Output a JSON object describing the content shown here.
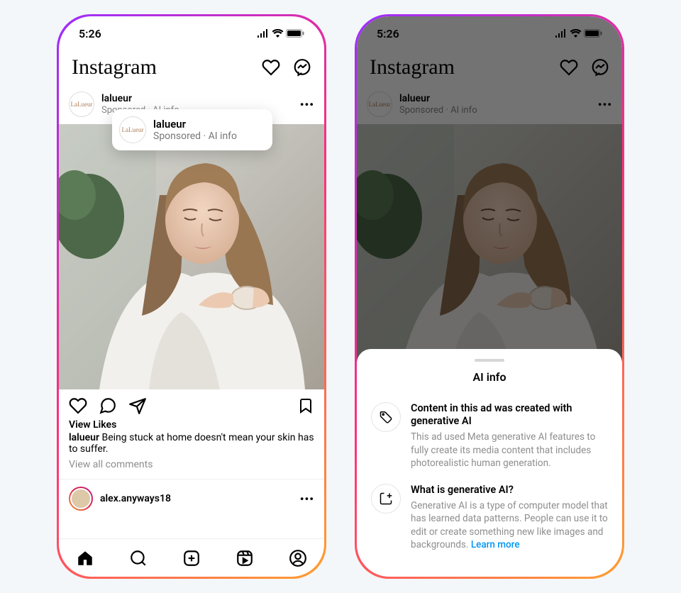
{
  "status": {
    "time": "5:26"
  },
  "header": {
    "logo_text": "Instagram"
  },
  "post": {
    "username": "lalueur",
    "sponsored_line": "Sponsored · AI info",
    "view_likes": "View Likes",
    "caption_user": "lalueur",
    "caption_text": " Being stuck at home doesn't mean your skin has to suffer.",
    "view_comments": "View all comments"
  },
  "next_post": {
    "username": "alex.anyways18"
  },
  "popup": {
    "name": "lalueur",
    "sub": "Sponsored · AI info"
  },
  "sheet": {
    "title": "AI info",
    "row1": {
      "title": "Content in this ad was created with generative AI",
      "body": "This ad used Meta generative AI features to fully create its media content that includes photorealistic human generation."
    },
    "row2": {
      "title": "What is generative AI?",
      "body": "Generative AI is a type of computer model that has learned data patterns. People can use it to edit or create something new like images and backgrounds. ",
      "learn_more": "Learn more"
    }
  },
  "avatar_text": "LaLueur"
}
